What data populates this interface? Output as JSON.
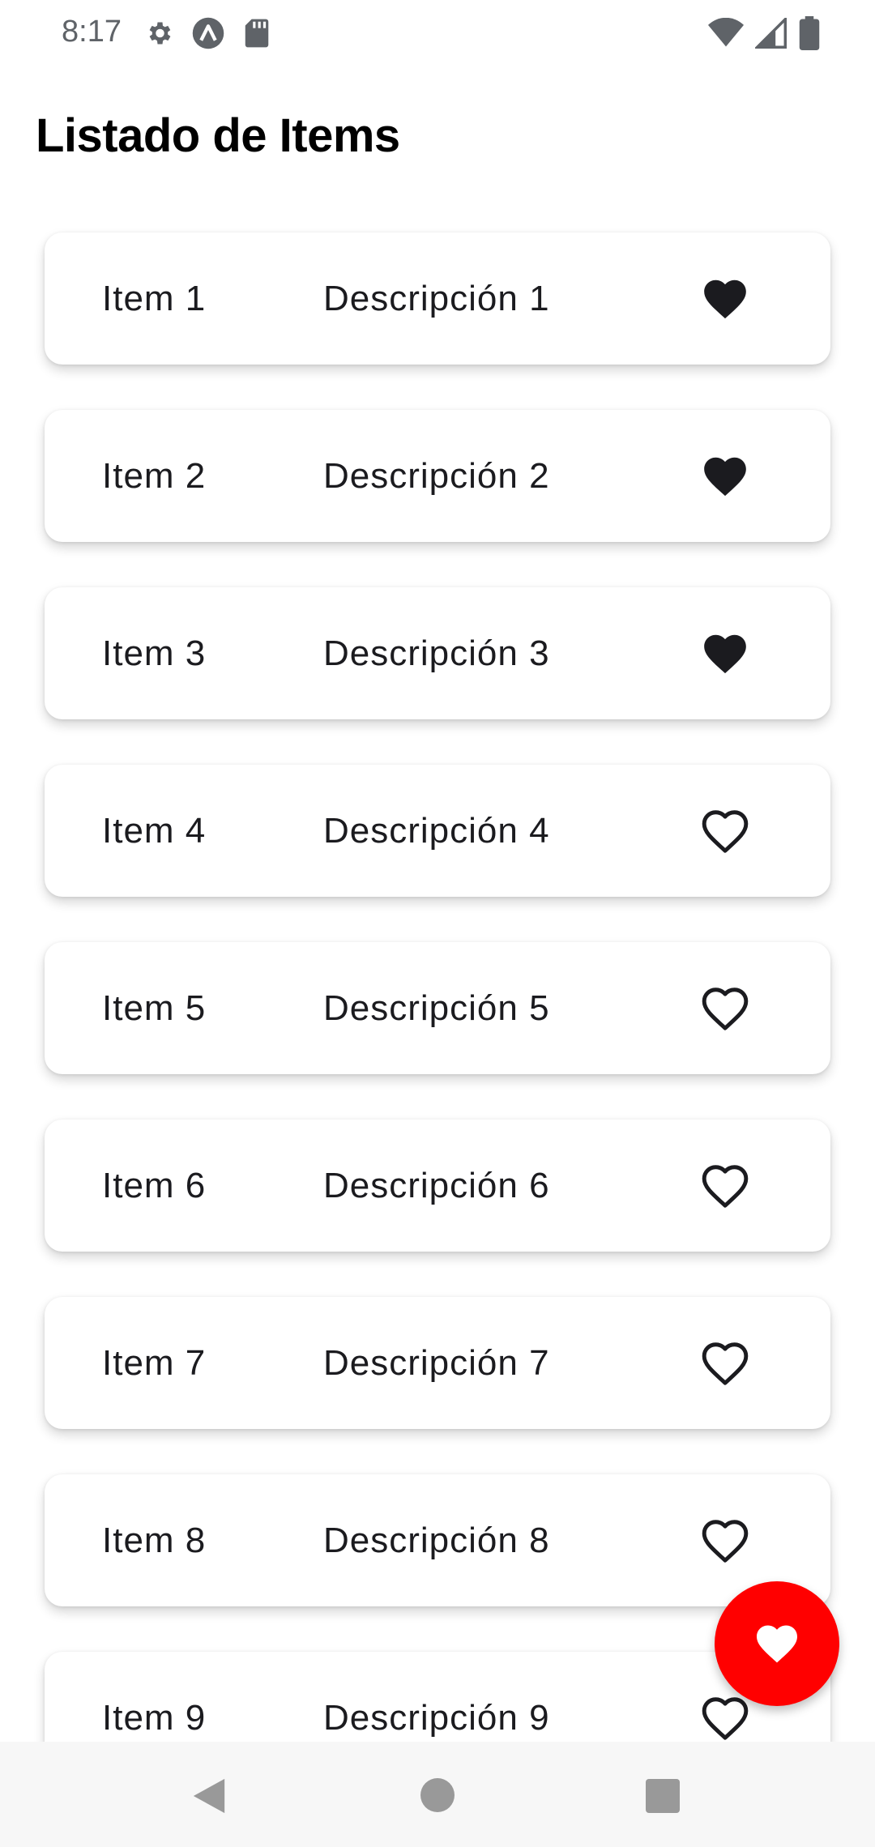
{
  "status_bar": {
    "time": "8:17",
    "left_icons": [
      "gear-icon",
      "lambda-icon",
      "sd-card-icon"
    ],
    "right_icons": [
      "wifi-icon",
      "cellular-signal-icon",
      "battery-icon"
    ]
  },
  "page": {
    "title": "Listado de Items"
  },
  "items": [
    {
      "name": "Item 1",
      "description": "Descripción 1",
      "favorite": true
    },
    {
      "name": "Item 2",
      "description": "Descripción 2",
      "favorite": true
    },
    {
      "name": "Item 3",
      "description": "Descripción 3",
      "favorite": true
    },
    {
      "name": "Item 4",
      "description": "Descripción 4",
      "favorite": false
    },
    {
      "name": "Item 5",
      "description": "Descripción 5",
      "favorite": false
    },
    {
      "name": "Item 6",
      "description": "Descripción 6",
      "favorite": false
    },
    {
      "name": "Item 7",
      "description": "Descripción 7",
      "favorite": false
    },
    {
      "name": "Item 8",
      "description": "Descripción 8",
      "favorite": false
    },
    {
      "name": "Item 9",
      "description": "Descripción 9",
      "favorite": false
    }
  ],
  "fab": {
    "icon": "heart-icon",
    "color": "#ff0000"
  },
  "nav_bar": {
    "buttons": [
      "back-triangle-icon",
      "home-circle-icon",
      "recents-square-icon"
    ]
  },
  "colors": {
    "favorite_filled": "#1b1b1f",
    "fab_background": "#ff0000",
    "fab_icon": "#ffffff"
  }
}
